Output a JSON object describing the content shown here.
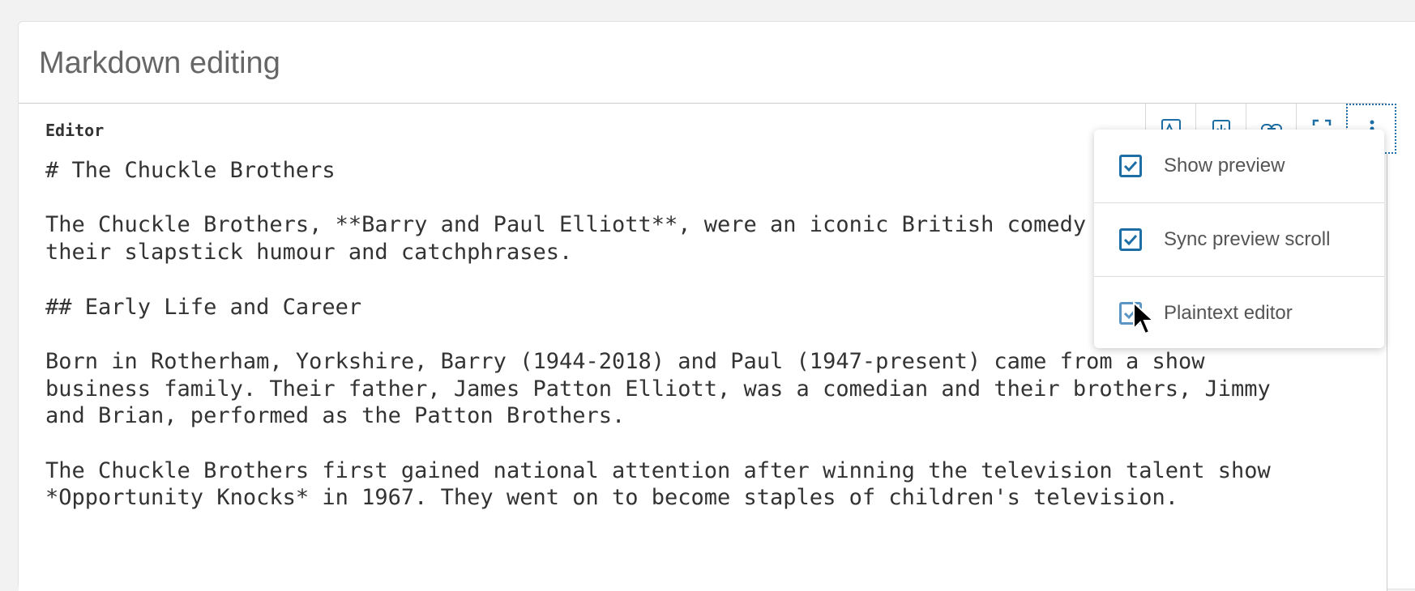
{
  "card": {
    "title": "Markdown editing"
  },
  "toolbar": {
    "label": "Editor",
    "buttons": [
      {
        "name": "image-icon"
      },
      {
        "name": "insert-icon"
      },
      {
        "name": "link-icon"
      },
      {
        "name": "fullscreen-icon"
      },
      {
        "name": "more-options-icon"
      }
    ]
  },
  "editor": {
    "lines": [
      "# The Chuckle Brothers",
      "",
      "The Chuckle Brothers, **Barry and Paul Elliott**, were an iconic British comedy duo known for",
      "their slapstick humour and catchphrases.",
      "",
      "## Early Life and Career",
      "",
      "Born in Rotherham, Yorkshire, Barry (1944-2018) and Paul (1947-present) came from a show",
      "business family. Their father, James Patton Elliott, was a comedian and their brothers, Jimmy",
      "and Brian, performed as the Patton Brothers.",
      "",
      "The Chuckle Brothers first gained national attention after winning the television talent show",
      "*Opportunity Knocks* in 1967. They went on to become staples of children's television."
    ]
  },
  "dropdown": {
    "items": [
      {
        "label": "Show preview",
        "checked": true
      },
      {
        "label": "Sync preview scroll",
        "checked": true
      },
      {
        "label": "Plaintext editor",
        "checked": true
      }
    ]
  },
  "colors": {
    "accent": "#1c6ea4",
    "text": "#333333",
    "title": "#666666"
  }
}
